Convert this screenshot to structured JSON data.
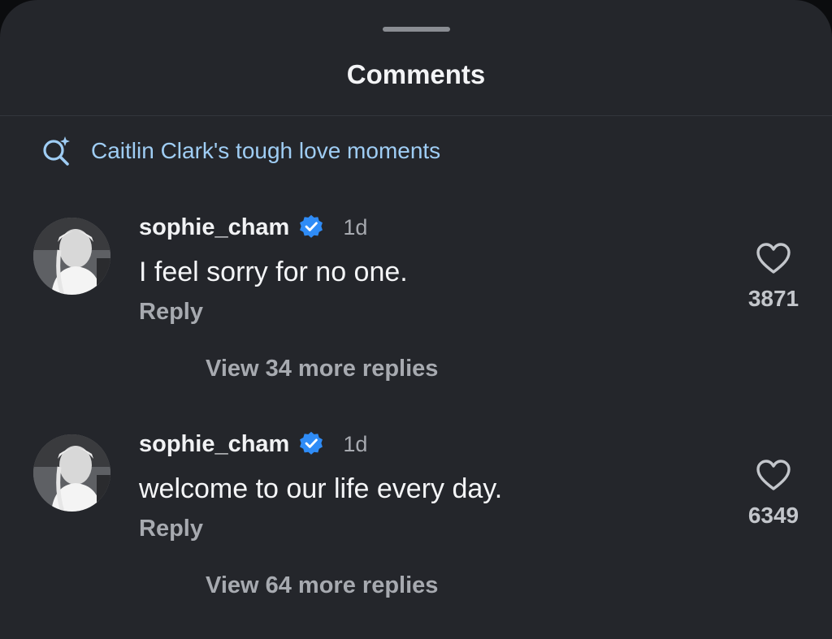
{
  "sheet": {
    "title": "Comments"
  },
  "search_suggestion": {
    "icon": "search-sparkle-icon",
    "text": "Caitlin Clark's tough love moments",
    "color": "#9fcdf4"
  },
  "comments": [
    {
      "username": "sophie_cham",
      "verified": true,
      "timestamp": "1d",
      "text": "I feel sorry for no one.",
      "reply_label": "Reply",
      "view_replies_label": "View 34 more replies",
      "like_count": "3871"
    },
    {
      "username": "sophie_cham",
      "verified": true,
      "timestamp": "1d",
      "text": "welcome to our life every day.",
      "reply_label": "Reply",
      "view_replies_label": "View 64 more replies",
      "like_count": "6349"
    }
  ],
  "colors": {
    "background": "#24262b",
    "verified_badge": "#2f8cf7",
    "primary_text": "#f3f4f6",
    "secondary_text": "#a7aab0"
  }
}
